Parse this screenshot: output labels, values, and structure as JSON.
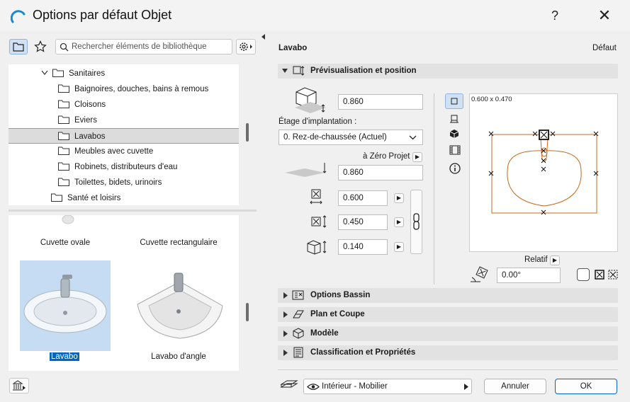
{
  "window": {
    "title": "Options par défaut Objet",
    "help": "?",
    "close": "✕"
  },
  "library": {
    "search_placeholder": "Rechercher éléments de bibliothèque",
    "tree": [
      {
        "label": "Sanitaires",
        "level": 1,
        "expanded": true
      },
      {
        "label": "Baignoires, douches, bains à remous",
        "level": 2
      },
      {
        "label": "Cloisons",
        "level": 2
      },
      {
        "label": "Eviers",
        "level": 2
      },
      {
        "label": "Lavabos",
        "level": 2,
        "selected": true
      },
      {
        "label": "Meubles avec cuvette",
        "level": 2
      },
      {
        "label": "Robinets, distributeurs d'eau",
        "level": 2
      },
      {
        "label": "Toilettes, bidets, urinoirs",
        "level": 2
      },
      {
        "label": "Santé et loisirs",
        "level": 1
      }
    ],
    "thumbnails": [
      {
        "label": "Cuvette ovale"
      },
      {
        "label": "Cuvette rectangulaire"
      },
      {
        "label": "Lavabo",
        "selected": true
      },
      {
        "label": "Lavabo d'angle"
      }
    ]
  },
  "object": {
    "name": "Lavabo",
    "defaults_label": "Défaut"
  },
  "sections": {
    "preview_position": "Prévisualisation et position",
    "options_bassin": "Options Bassin",
    "plan_coupe": "Plan et Coupe",
    "modele": "Modèle",
    "classification": "Classification et Propriétés"
  },
  "position": {
    "top_elevation": "0.860",
    "story_label": "Étage d'implantation :",
    "story_value": "0. Rez-de-chaussée (Actuel)",
    "reference_label": "à Zéro Projet",
    "base_elevation": "0.860",
    "width": "0.600",
    "depth": "0.450",
    "height": "0.140"
  },
  "preview": {
    "dimensions": "0.600 x 0.470",
    "relative_label": "Relatif",
    "angle": "0.00°",
    "line_color": "#c9691a"
  },
  "footer": {
    "layer": "Intérieur - Mobilier",
    "cancel": "Annuler",
    "ok": "OK"
  },
  "colors": {
    "accent": "#0067c0",
    "selection": "#c6dcf2"
  }
}
